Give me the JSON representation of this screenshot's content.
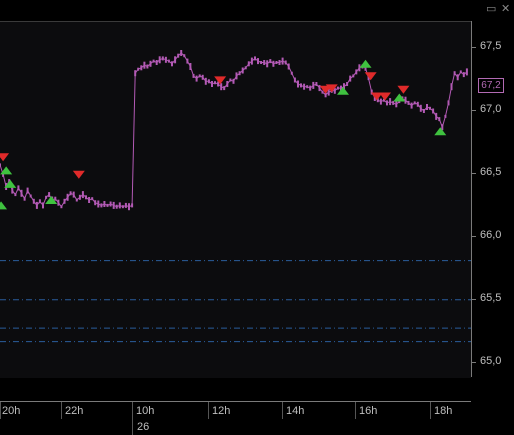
{
  "window": {
    "maximize_icon": "maximize-icon",
    "close_icon": "close-icon"
  },
  "chart_data": {
    "type": "line",
    "style": "ohlc-candles-with-signal-markers",
    "title": "",
    "y_ticks": [
      "67,5",
      "67,0",
      "66,5",
      "66,0",
      "65,5",
      "65,0"
    ],
    "y_tick_values": [
      67.5,
      67.0,
      66.5,
      66.0,
      65.5,
      65.0
    ],
    "ylim": [
      64.94,
      67.58
    ],
    "current_price_label": "67,2",
    "current_price": 67.21,
    "x_ticks": [
      "20h",
      "22h",
      "10h",
      "12h",
      "14h",
      "16h",
      "18h"
    ],
    "date_label": "26",
    "reference_levels": [
      65.81,
      65.52,
      65.31,
      65.21
    ],
    "price_series": [
      {
        "t": 0,
        "v": 66.52
      },
      {
        "t": 3,
        "v": 66.45
      },
      {
        "t": 6,
        "v": 66.36
      },
      {
        "t": 9,
        "v": 66.4
      },
      {
        "t": 12,
        "v": 66.33
      },
      {
        "t": 15,
        "v": 66.3
      },
      {
        "t": 18,
        "v": 66.35
      },
      {
        "t": 21,
        "v": 66.31
      },
      {
        "t": 24,
        "v": 66.27
      },
      {
        "t": 27,
        "v": 66.33
      },
      {
        "t": 30,
        "v": 66.29
      },
      {
        "t": 33,
        "v": 66.25
      },
      {
        "t": 36,
        "v": 66.22
      },
      {
        "t": 39,
        "v": 66.25
      },
      {
        "t": 42,
        "v": 66.22
      },
      {
        "t": 45,
        "v": 66.28
      },
      {
        "t": 48,
        "v": 66.3
      },
      {
        "t": 51,
        "v": 66.26
      },
      {
        "t": 54,
        "v": 66.27
      },
      {
        "t": 57,
        "v": 66.24
      },
      {
        "t": 60,
        "v": 66.21
      },
      {
        "t": 63,
        "v": 66.25
      },
      {
        "t": 66,
        "v": 66.28
      },
      {
        "t": 69,
        "v": 66.31
      },
      {
        "t": 72,
        "v": 66.3
      },
      {
        "t": 75,
        "v": 66.26
      },
      {
        "t": 78,
        "v": 66.28
      },
      {
        "t": 81,
        "v": 66.3
      },
      {
        "t": 84,
        "v": 66.28
      },
      {
        "t": 87,
        "v": 66.26
      },
      {
        "t": 90,
        "v": 66.27
      },
      {
        "t": 93,
        "v": 66.24
      },
      {
        "t": 96,
        "v": 66.23
      },
      {
        "t": 99,
        "v": 66.22
      },
      {
        "t": 102,
        "v": 66.23
      },
      {
        "t": 105,
        "v": 66.22
      },
      {
        "t": 108,
        "v": 66.23
      },
      {
        "t": 111,
        "v": 66.22
      },
      {
        "t": 114,
        "v": 66.21
      },
      {
        "t": 117,
        "v": 66.22
      },
      {
        "t": 120,
        "v": 66.21
      },
      {
        "t": 123,
        "v": 66.22
      },
      {
        "t": 126,
        "v": 66.21
      },
      {
        "t": 129,
        "v": 66.22
      },
      {
        "t": 132,
        "v": 67.2
      },
      {
        "t": 135,
        "v": 67.23
      },
      {
        "t": 138,
        "v": 67.24
      },
      {
        "t": 141,
        "v": 67.26
      },
      {
        "t": 144,
        "v": 67.25
      },
      {
        "t": 147,
        "v": 67.27
      },
      {
        "t": 150,
        "v": 67.29
      },
      {
        "t": 153,
        "v": 67.28
      },
      {
        "t": 156,
        "v": 67.3
      },
      {
        "t": 159,
        "v": 67.31
      },
      {
        "t": 162,
        "v": 67.3
      },
      {
        "t": 165,
        "v": 67.29
      },
      {
        "t": 168,
        "v": 67.27
      },
      {
        "t": 171,
        "v": 67.3
      },
      {
        "t": 174,
        "v": 67.33
      },
      {
        "t": 177,
        "v": 67.35
      },
      {
        "t": 180,
        "v": 67.33
      },
      {
        "t": 183,
        "v": 67.29
      },
      {
        "t": 186,
        "v": 67.25
      },
      {
        "t": 189,
        "v": 67.18
      },
      {
        "t": 192,
        "v": 67.16
      },
      {
        "t": 195,
        "v": 67.18
      },
      {
        "t": 198,
        "v": 67.17
      },
      {
        "t": 201,
        "v": 67.14
      },
      {
        "t": 204,
        "v": 67.14
      },
      {
        "t": 207,
        "v": 67.12
      },
      {
        "t": 210,
        "v": 67.13
      },
      {
        "t": 213,
        "v": 67.12
      },
      {
        "t": 216,
        "v": 67.1
      },
      {
        "t": 219,
        "v": 67.09
      },
      {
        "t": 222,
        "v": 67.12
      },
      {
        "t": 225,
        "v": 67.15
      },
      {
        "t": 228,
        "v": 67.14
      },
      {
        "t": 231,
        "v": 67.18
      },
      {
        "t": 234,
        "v": 67.2
      },
      {
        "t": 237,
        "v": 67.22
      },
      {
        "t": 240,
        "v": 67.24
      },
      {
        "t": 243,
        "v": 67.27
      },
      {
        "t": 246,
        "v": 67.29
      },
      {
        "t": 249,
        "v": 67.31
      },
      {
        "t": 252,
        "v": 67.29
      },
      {
        "t": 255,
        "v": 67.28
      },
      {
        "t": 258,
        "v": 67.28
      },
      {
        "t": 261,
        "v": 67.27
      },
      {
        "t": 264,
        "v": 67.29
      },
      {
        "t": 267,
        "v": 67.27
      },
      {
        "t": 270,
        "v": 67.28
      },
      {
        "t": 273,
        "v": 67.28
      },
      {
        "t": 276,
        "v": 67.29
      },
      {
        "t": 279,
        "v": 67.28
      },
      {
        "t": 282,
        "v": 67.25
      },
      {
        "t": 285,
        "v": 67.2
      },
      {
        "t": 288,
        "v": 67.15
      },
      {
        "t": 291,
        "v": 67.12
      },
      {
        "t": 294,
        "v": 67.11
      },
      {
        "t": 297,
        "v": 67.1
      },
      {
        "t": 300,
        "v": 67.1
      },
      {
        "t": 303,
        "v": 67.09
      },
      {
        "t": 306,
        "v": 67.11
      },
      {
        "t": 309,
        "v": 67.12
      },
      {
        "t": 312,
        "v": 67.09
      },
      {
        "t": 315,
        "v": 67.06
      },
      {
        "t": 318,
        "v": 67.04
      },
      {
        "t": 321,
        "v": 67.06
      },
      {
        "t": 324,
        "v": 67.07
      },
      {
        "t": 327,
        "v": 67.07
      },
      {
        "t": 330,
        "v": 67.09
      },
      {
        "t": 333,
        "v": 67.09
      },
      {
        "t": 336,
        "v": 67.1
      },
      {
        "t": 339,
        "v": 67.12
      },
      {
        "t": 342,
        "v": 67.16
      },
      {
        "t": 345,
        "v": 67.18
      },
      {
        "t": 348,
        "v": 67.21
      },
      {
        "t": 351,
        "v": 67.24
      },
      {
        "t": 354,
        "v": 67.25
      },
      {
        "t": 357,
        "v": 67.24
      },
      {
        "t": 360,
        "v": 67.16
      },
      {
        "t": 363,
        "v": 67.06
      },
      {
        "t": 366,
        "v": 67.02
      },
      {
        "t": 369,
        "v": 67.0
      },
      {
        "t": 372,
        "v": 66.99
      },
      {
        "t": 375,
        "v": 67.0
      },
      {
        "t": 378,
        "v": 66.98
      },
      {
        "t": 381,
        "v": 66.99
      },
      {
        "t": 384,
        "v": 66.98
      },
      {
        "t": 387,
        "v": 66.97
      },
      {
        "t": 390,
        "v": 66.99
      },
      {
        "t": 393,
        "v": 67.01
      },
      {
        "t": 396,
        "v": 67.0
      },
      {
        "t": 399,
        "v": 66.98
      },
      {
        "t": 402,
        "v": 66.96
      },
      {
        "t": 405,
        "v": 66.98
      },
      {
        "t": 408,
        "v": 66.97
      },
      {
        "t": 411,
        "v": 66.94
      },
      {
        "t": 414,
        "v": 66.92
      },
      {
        "t": 417,
        "v": 66.95
      },
      {
        "t": 420,
        "v": 66.94
      },
      {
        "t": 423,
        "v": 66.92
      },
      {
        "t": 426,
        "v": 66.88
      },
      {
        "t": 429,
        "v": 66.86
      },
      {
        "t": 432,
        "v": 66.8
      },
      {
        "t": 435,
        "v": 66.88
      },
      {
        "t": 438,
        "v": 66.98
      },
      {
        "t": 441,
        "v": 67.1
      },
      {
        "t": 444,
        "v": 67.2
      },
      {
        "t": 447,
        "v": 67.17
      },
      {
        "t": 450,
        "v": 67.21
      },
      {
        "t": 453,
        "v": 67.19
      },
      {
        "t": 456,
        "v": 67.21
      }
    ],
    "sell_signals": [
      {
        "t": 3,
        "v": 66.57
      },
      {
        "t": 77,
        "v": 66.44
      },
      {
        "t": 215,
        "v": 67.14
      },
      {
        "t": 318,
        "v": 67.07
      },
      {
        "t": 324,
        "v": 67.08
      },
      {
        "t": 362,
        "v": 67.17
      },
      {
        "t": 368,
        "v": 67.02
      },
      {
        "t": 376,
        "v": 67.02
      },
      {
        "t": 394,
        "v": 67.07
      }
    ],
    "buy_signals": [
      {
        "t": 1,
        "v": 66.22
      },
      {
        "t": 6,
        "v": 66.48
      },
      {
        "t": 10,
        "v": 66.38
      },
      {
        "t": 50,
        "v": 66.26
      },
      {
        "t": 335,
        "v": 67.07
      },
      {
        "t": 357,
        "v": 67.27
      },
      {
        "t": 390,
        "v": 67.02
      },
      {
        "t": 430,
        "v": 66.77
      }
    ],
    "colors": {
      "price": "#b35ab5",
      "sell_marker": "#e02a2a",
      "buy_marker": "#3fc23f",
      "reference_line": "#2a5d9c",
      "plot_bg": "#0c0c0e"
    }
  }
}
